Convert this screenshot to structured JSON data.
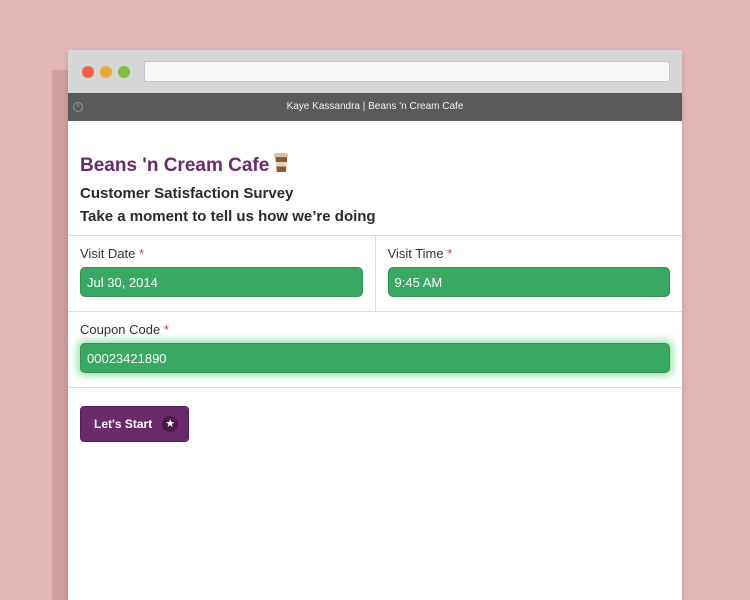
{
  "window": {
    "title": "Kaye Kassandra | Beans 'n Cream Cafe",
    "url": ""
  },
  "header": {
    "brand": "Beans 'n Cream Cafe",
    "subtitle": "Customer Satisfaction Survey",
    "tagline": "Take a moment to tell us how we’re doing"
  },
  "form": {
    "visit_date": {
      "label": "Visit Date",
      "required": "*",
      "value": "Jul 30, 2014"
    },
    "visit_time": {
      "label": "Visit Time",
      "required": "*",
      "value": "9:45 AM"
    },
    "coupon_code": {
      "label": "Coupon Code",
      "required": "*",
      "value": "00023421890"
    }
  },
  "actions": {
    "start_label": "Let's Start",
    "start_icon": "★"
  },
  "icons": {
    "brand_icon": "coffee-cup-icon",
    "close": "close-icon",
    "button_icon": "star-icon"
  },
  "colors": {
    "background": "#e3b6b6",
    "brand": "#6b2a6b",
    "field": "#38a862",
    "required": "#d23a3a",
    "titlebar": "#5a5a5a"
  }
}
